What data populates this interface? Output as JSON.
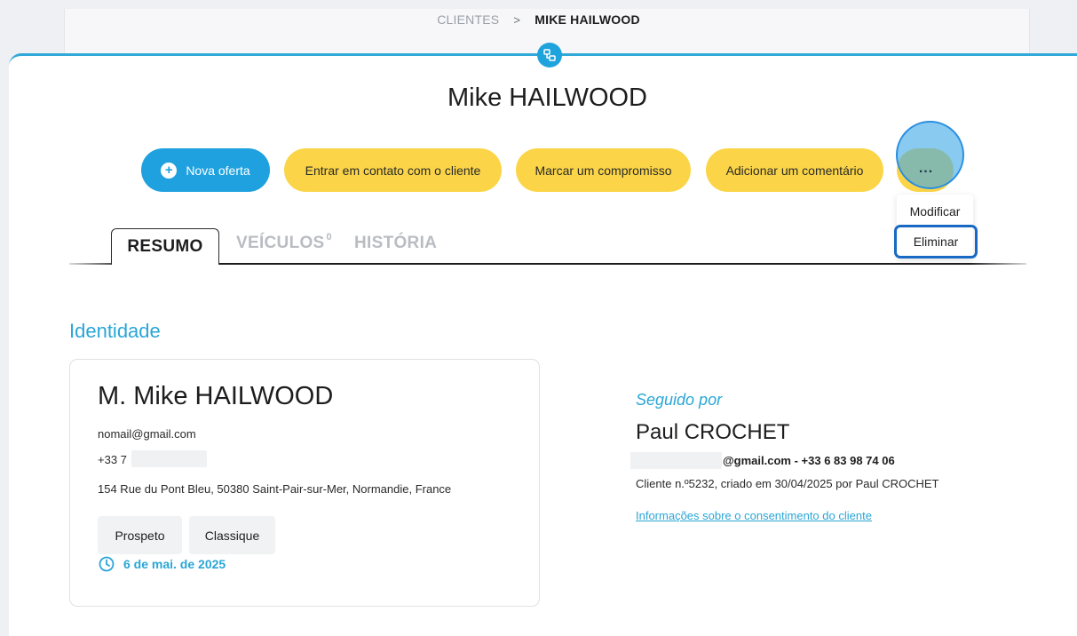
{
  "breadcrumb": {
    "parent": "CLIENTES",
    "separator": ">",
    "current": "MIKE HAILWOOD"
  },
  "page": {
    "title": "Mike HAILWOOD"
  },
  "actions": {
    "new_offer": "Nova oferta",
    "contact": "Entrar em contato com o cliente",
    "appointment": "Marcar um compromisso",
    "comment": "Adicionar um comentário",
    "more": "..."
  },
  "more_menu": {
    "items": [
      "Modificar",
      "Eliminar"
    ]
  },
  "tabs": [
    {
      "label": "RESUMO",
      "active": true
    },
    {
      "label": "VEÍCULOS",
      "badge": "0",
      "active": false
    },
    {
      "label": "HISTÓRIA",
      "active": false
    }
  ],
  "identity": {
    "section_title": "Identidade",
    "full_name": "M. Mike HAILWOOD",
    "email": "nomail@gmail.com",
    "phone_visible": "+33 7",
    "address": "154 Rue du Pont Bleu, 50380 Saint-Pair-sur-Mer, Normandie, France",
    "tags": [
      "Prospeto",
      "Classique"
    ],
    "date": "6 de mai. de 2025"
  },
  "followed_by": {
    "label": "Seguido por",
    "name": "Paul CROCHET",
    "contact": "@gmail.com - +33 6 83 98 74 06",
    "client_info": "Cliente n.º5232, criado em 30/04/2025 por Paul CROCHET",
    "consent_link": "Informações sobre o consentimento do cliente"
  },
  "colors": {
    "accent_blue": "#1ea1de",
    "action_yellow": "#fbd547",
    "section_blue": "#2aa6d6",
    "focus_outline": "#1869c4"
  }
}
